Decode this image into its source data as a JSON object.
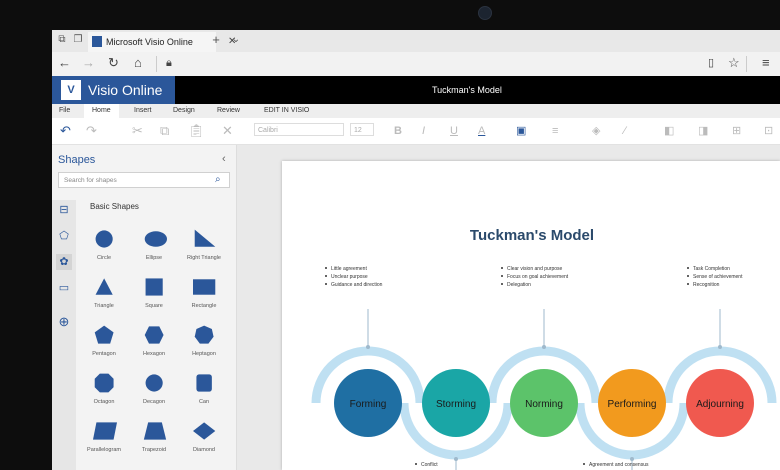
{
  "browser": {
    "tab_title": "Microsoft Visio Online",
    "new_tab": "+",
    "tab_menu": "⌄"
  },
  "app": {
    "brand": "Visio Online",
    "logo_text": "V",
    "document_title": "Tuckman's Model"
  },
  "ribbon": {
    "tabs": [
      "File",
      "Home",
      "Insert",
      "Design",
      "Review",
      "EDIT IN VISIO"
    ],
    "active_tab": "Home",
    "font_name": "Calibri",
    "font_size": "12"
  },
  "toolbar": {
    "bold": "B",
    "italic": "I",
    "underline": "U",
    "font_color": "A"
  },
  "shapes_panel": {
    "title": "Shapes",
    "search_placeholder": "Search for shapes",
    "section_title": "Basic Shapes",
    "shapes": [
      "Circle",
      "Ellipse",
      "Right Triangle",
      "Triangle",
      "Square",
      "Rectangle",
      "Pentagon",
      "Hexagon",
      "Heptagon",
      "Octagon",
      "Decagon",
      "Can",
      "Parallelogram",
      "Trapezoid",
      "Diamond"
    ]
  },
  "diagram": {
    "title": "Tuckman's Model",
    "stages": [
      {
        "label": "Forming",
        "color": "#1f6fa3"
      },
      {
        "label": "Storming",
        "color": "#1aa6a6"
      },
      {
        "label": "Norming",
        "color": "#5cc36a"
      },
      {
        "label": "Performing",
        "color": "#f29a1e"
      },
      {
        "label": "Adjourning",
        "color": "#f0594f"
      }
    ],
    "ring_color": "#bfe0f2",
    "top_notes": [
      [
        "Little agreement",
        "Unclear purpose",
        "Guidance and direction"
      ],
      [
        "Clear vision and purpose",
        "Focus on goal achievement",
        "Delegation"
      ],
      [
        "Task Completion",
        "Sense of achievement",
        "Recognition"
      ]
    ],
    "bottom_notes": [
      "Conflict",
      "Agreement and consensus"
    ]
  },
  "colors": {
    "accent": "#2b579a",
    "title_color": "#2b4a6b"
  }
}
